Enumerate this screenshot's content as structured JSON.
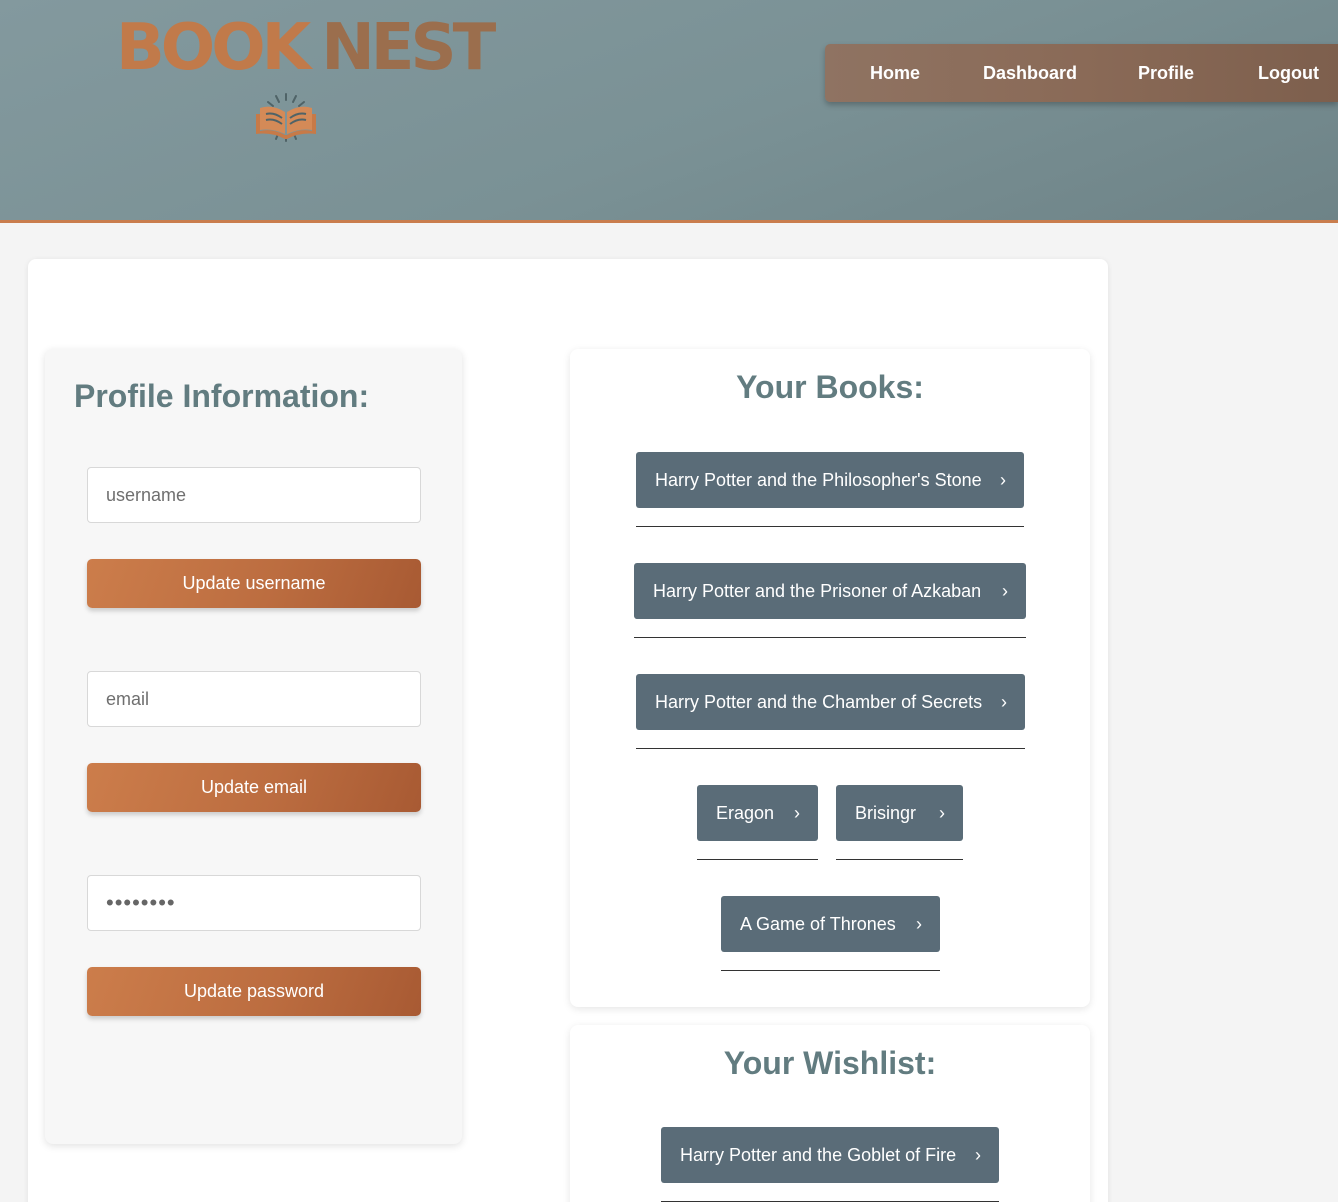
{
  "header": {
    "logo_word1": "BOOK",
    "logo_word2": "NEST",
    "logo_icon": "open-book-icon",
    "nav": [
      "Home",
      "Dashboard",
      "Profile",
      "Logout"
    ]
  },
  "profile": {
    "title": "Profile Information:",
    "username_placeholder": "username",
    "update_username_label": "Update username",
    "email_placeholder": "email",
    "update_email_label": "Update email",
    "password_value": "••••••••",
    "update_password_label": "Update password"
  },
  "books": {
    "title": "Your Books:",
    "items": [
      "Harry Potter and the Philosopher's Stone",
      "Harry Potter and the Prisoner of Azkaban",
      "Harry Potter and the Chamber of Secrets",
      "Eragon",
      "Brisingr",
      "A Game of Thrones"
    ]
  },
  "wishlist": {
    "title": "Your Wishlist:",
    "items": [
      "Harry Potter and the Goblet of Fire"
    ]
  },
  "icons": {
    "chevron": "chevron-right-icon"
  },
  "colors": {
    "header_bg": "#7f9599",
    "accent_orange": "#c17a4a",
    "book_button": "#5a6c78",
    "title_text": "#627c80"
  }
}
